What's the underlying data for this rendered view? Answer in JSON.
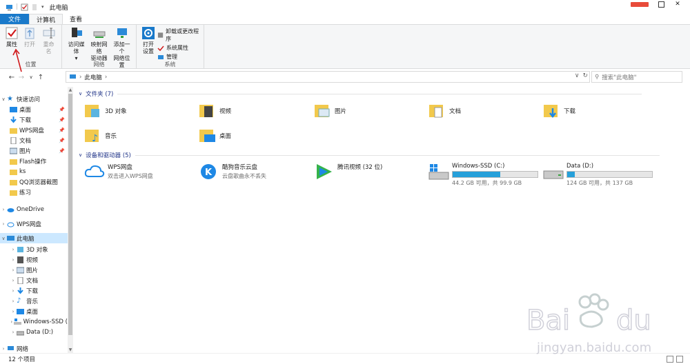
{
  "window": {
    "title": "此电脑",
    "qat_separator": "|"
  },
  "tabs": [
    {
      "label": "文件"
    },
    {
      "label": "计算机"
    },
    {
      "label": "查看"
    }
  ],
  "ribbon": {
    "location_group": {
      "label": "位置",
      "properties": "属性",
      "open": "打开",
      "rename": "重命名"
    },
    "network_group": {
      "label": "网络",
      "media_line1": "访问媒体",
      "map_line1": "映射网络",
      "map_line2": "驱动器",
      "add_line1": "添加一个",
      "add_line2": "网络位置"
    },
    "system_group": {
      "label": "系统",
      "open_settings_line1": "打开",
      "open_settings_line2": "设置",
      "uninstall": "卸载或更改程序",
      "sys_props": "系统属性",
      "manage": "管理"
    }
  },
  "address": {
    "path": "此电脑",
    "search_placeholder": "搜索\"此电脑\""
  },
  "nav": {
    "quick_access": "快速访问",
    "quick_items": [
      {
        "label": "桌面",
        "pinned": true
      },
      {
        "label": "下载",
        "pinned": true
      },
      {
        "label": "WPS网盘",
        "pinned": true
      },
      {
        "label": "文档",
        "pinned": true
      },
      {
        "label": "图片",
        "pinned": true
      },
      {
        "label": "Flash操作",
        "pinned": false
      },
      {
        "label": "ks",
        "pinned": false
      },
      {
        "label": "QQ浏览器截图",
        "pinned": false
      },
      {
        "label": "练习",
        "pinned": false
      }
    ],
    "onedrive": "OneDrive",
    "wps": "WPS网盘",
    "this_pc": "此电脑",
    "pc_items": [
      "3D 对象",
      "视频",
      "图片",
      "文档",
      "下载",
      "音乐",
      "桌面",
      "Windows-SSD (",
      "Data (D:)",
      "网络"
    ]
  },
  "content": {
    "folders_header": "文件夹 (7)",
    "folders": [
      "3D 对象",
      "视频",
      "图片",
      "文档",
      "下载",
      "音乐",
      "桌面"
    ],
    "devices_header": "设备和驱动器 (5)",
    "devices": [
      {
        "name": "WPS网盘",
        "sub": "双击进入WPS网盘"
      },
      {
        "name": "酷狗音乐云盘",
        "sub": "云盘歌曲永不丢失"
      },
      {
        "name": "腾讯视频 (32 位)",
        "sub": ""
      }
    ],
    "drives": [
      {
        "name": "Windows-SSD (C:)",
        "sub": "44.2 GB 可用，共 99.9 GB",
        "used_fraction": 0.56
      },
      {
        "name": "Data (D:)",
        "sub": "124 GB 可用，共 137 GB",
        "used_fraction": 0.09
      }
    ]
  },
  "status": {
    "count": "12 个项目"
  },
  "colors": {
    "accent": "#1979ca",
    "folder": "#f2c94c",
    "bar_fill": "#26a0da",
    "arrow": "#d0191b"
  }
}
